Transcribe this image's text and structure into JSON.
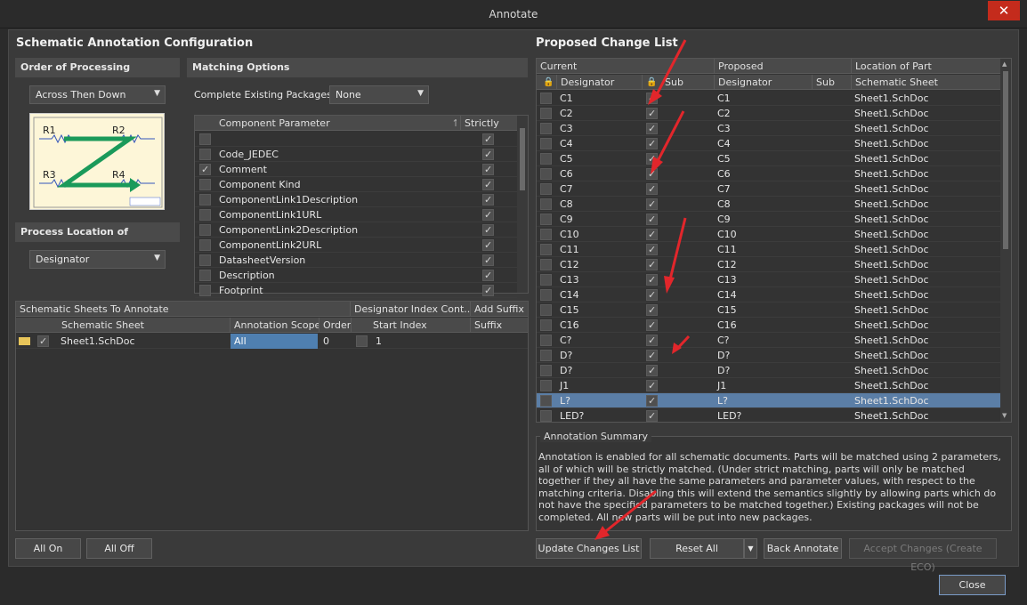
{
  "window": {
    "title": "Annotate",
    "close_glyph": "✕"
  },
  "left": {
    "title": "Schematic Annotation Configuration",
    "order_of_processing": {
      "label": "Order of Processing",
      "value": "Across Then Down"
    },
    "process_location": {
      "label": "Process Location of",
      "value": "Designator"
    },
    "matching": {
      "label": "Matching Options",
      "complete_label": "Complete Existing Packages",
      "complete_value": "None",
      "param_col": "Component Parameter",
      "strictly_col": "Strictly",
      "params": [
        {
          "name": "",
          "checked": false,
          "strict": true
        },
        {
          "name": "Code_JEDEC",
          "checked": false,
          "strict": true
        },
        {
          "name": "Comment",
          "checked": true,
          "strict": true
        },
        {
          "name": "Component Kind",
          "checked": false,
          "strict": true
        },
        {
          "name": "ComponentLink1Description",
          "checked": false,
          "strict": true
        },
        {
          "name": "ComponentLink1URL",
          "checked": false,
          "strict": true
        },
        {
          "name": "ComponentLink2Description",
          "checked": false,
          "strict": true
        },
        {
          "name": "ComponentLink2URL",
          "checked": false,
          "strict": true
        },
        {
          "name": "DatasheetVersion",
          "checked": false,
          "strict": true
        },
        {
          "name": "Description",
          "checked": false,
          "strict": true
        },
        {
          "name": "Footprint",
          "checked": false,
          "strict": true
        }
      ]
    },
    "preview": {
      "r1": "R1",
      "r2": "R2",
      "r3": "R3",
      "r4": "R4"
    },
    "sheets": {
      "group1": "Schematic Sheets To Annotate",
      "group2": "Designator Index Cont...",
      "group3": "Add Suffix",
      "col_sheet": "Schematic Sheet",
      "col_scope": "Annotation Scope",
      "col_order": "Order",
      "col_start": "Start Index",
      "col_suffix": "Suffix",
      "rows": [
        {
          "sheet": "Sheet1.SchDoc",
          "scope": "All",
          "order": "0",
          "start": "1",
          "suffix": ""
        }
      ]
    },
    "all_on": "All On",
    "all_off": "All Off"
  },
  "right": {
    "title": "Proposed Change List",
    "group_current": "Current",
    "group_proposed": "Proposed",
    "group_location": "Location of Part",
    "col_designator": "Designator",
    "col_sub": "Sub",
    "col_pdesignator": "Designator",
    "col_psub": "Sub",
    "col_sheet": "Schematic Sheet",
    "rows": [
      {
        "cur": "C1",
        "prop": "C1",
        "sheet": "Sheet1.SchDoc"
      },
      {
        "cur": "C2",
        "prop": "C2",
        "sheet": "Sheet1.SchDoc"
      },
      {
        "cur": "C3",
        "prop": "C3",
        "sheet": "Sheet1.SchDoc"
      },
      {
        "cur": "C4",
        "prop": "C4",
        "sheet": "Sheet1.SchDoc"
      },
      {
        "cur": "C5",
        "prop": "C5",
        "sheet": "Sheet1.SchDoc"
      },
      {
        "cur": "C6",
        "prop": "C6",
        "sheet": "Sheet1.SchDoc"
      },
      {
        "cur": "C7",
        "prop": "C7",
        "sheet": "Sheet1.SchDoc"
      },
      {
        "cur": "C8",
        "prop": "C8",
        "sheet": "Sheet1.SchDoc"
      },
      {
        "cur": "C9",
        "prop": "C9",
        "sheet": "Sheet1.SchDoc"
      },
      {
        "cur": "C10",
        "prop": "C10",
        "sheet": "Sheet1.SchDoc"
      },
      {
        "cur": "C11",
        "prop": "C11",
        "sheet": "Sheet1.SchDoc"
      },
      {
        "cur": "C12",
        "prop": "C12",
        "sheet": "Sheet1.SchDoc"
      },
      {
        "cur": "C13",
        "prop": "C13",
        "sheet": "Sheet1.SchDoc"
      },
      {
        "cur": "C14",
        "prop": "C14",
        "sheet": "Sheet1.SchDoc"
      },
      {
        "cur": "C15",
        "prop": "C15",
        "sheet": "Sheet1.SchDoc"
      },
      {
        "cur": "C16",
        "prop": "C16",
        "sheet": "Sheet1.SchDoc"
      },
      {
        "cur": "C?",
        "prop": "C?",
        "sheet": "Sheet1.SchDoc"
      },
      {
        "cur": "D?",
        "prop": "D?",
        "sheet": "Sheet1.SchDoc"
      },
      {
        "cur": "D?",
        "prop": "D?",
        "sheet": "Sheet1.SchDoc"
      },
      {
        "cur": "J1",
        "prop": "J1",
        "sheet": "Sheet1.SchDoc"
      },
      {
        "cur": "L?",
        "prop": "L?",
        "sheet": "Sheet1.SchDoc",
        "selected": true
      },
      {
        "cur": "LED?",
        "prop": "LED?",
        "sheet": "Sheet1.SchDoc"
      }
    ],
    "summary_title": "Annotation Summary",
    "summary_text": "Annotation is enabled for all schematic documents. Parts will be matched using 2 parameters, all of which will be strictly matched. (Under strict matching, parts will only be matched together if they all have the same parameters and parameter values, with respect to the matching criteria. Disabling this will extend the semantics slightly by allowing parts which do not have the specified parameters to be matched together.) Existing packages will not be completed. All new parts will be put into new packages.",
    "update_btn": "Update Changes List",
    "reset_btn": "Reset All",
    "back_btn": "Back Annotate",
    "accept_btn": "Accept Changes (Create ECO)"
  },
  "close_btn": "Close",
  "colors": {
    "selection": "#5b7ea6",
    "arrow": "#e2262b",
    "zgreen": "#1a9a5a"
  }
}
